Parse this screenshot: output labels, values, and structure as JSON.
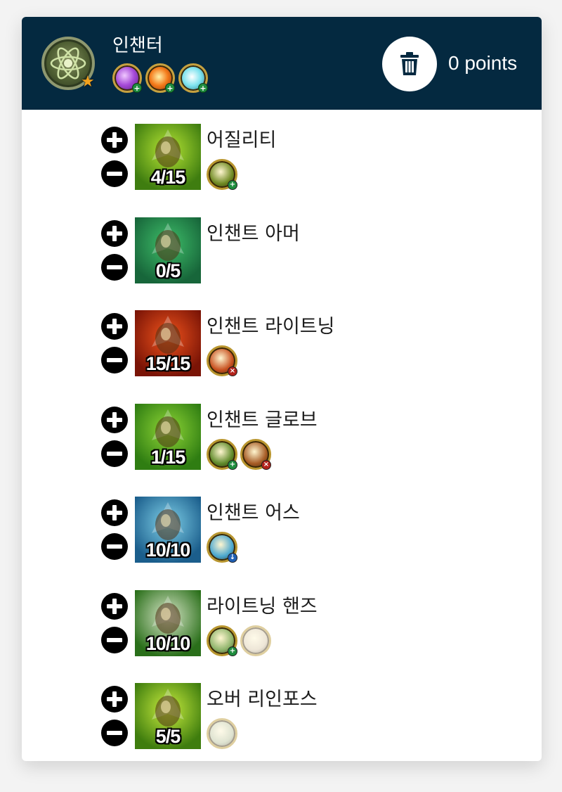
{
  "header": {
    "class_name": "인챈터",
    "points_label": "0 points",
    "class_icon": "atom-emblem-icon",
    "spec_icons": [
      "purple-orb-icon",
      "fire-orb-icon",
      "frost-orb-icon"
    ]
  },
  "skills": [
    {
      "name": "어질리티",
      "level": "4/15",
      "icon": "bracer-icon",
      "bg": [
        "#3f7d10",
        "#b6e534"
      ],
      "mods": [
        {
          "color": "#6f8a22",
          "badge": "green"
        }
      ]
    },
    {
      "name": "인챈트 아머",
      "level": "0/5",
      "icon": "armor-scroll-icon",
      "bg": [
        "#17663a",
        "#3fbf6a"
      ],
      "mods": []
    },
    {
      "name": "인챈트 라이트닝",
      "level": "15/15",
      "icon": "lightning-sigil-icon",
      "bg": [
        "#7a1406",
        "#f0531c"
      ],
      "mods": [
        {
          "color": "#c8501f",
          "badge": "red"
        }
      ]
    },
    {
      "name": "인챈트 글로브",
      "level": "1/15",
      "icon": "glove-icon",
      "bg": [
        "#2f7d12",
        "#8fd636"
      ],
      "mods": [
        {
          "color": "#5f8a2a",
          "badge": "green"
        },
        {
          "color": "#a65b24",
          "badge": "red"
        }
      ]
    },
    {
      "name": "인챈트 어스",
      "level": "10/10",
      "icon": "earth-shield-icon",
      "bg": [
        "#1b5e8c",
        "#7fd0e8"
      ],
      "mods": [
        {
          "color": "#4aa7cf",
          "badge": "blue"
        }
      ]
    },
    {
      "name": "라이트닝 핸즈",
      "level": "10/10",
      "icon": "lightning-hands-icon",
      "bg": [
        "#2a6f1a",
        "#d8e6c8"
      ],
      "mods": [
        {
          "color": "#8db36a",
          "badge": "green"
        },
        {
          "color": "#d9c9a8",
          "badge": "none",
          "faded": true
        }
      ]
    },
    {
      "name": "오버 리인포스",
      "level": "5/5",
      "icon": "golden-dagger-icon",
      "bg": [
        "#3f7d0e",
        "#c8ec3e"
      ],
      "mods": [
        {
          "color": "#b8c29a",
          "badge": "none",
          "faded": true
        }
      ]
    }
  ],
  "colors": {
    "header_bg": "#042940",
    "text": "#1c1c1c"
  }
}
